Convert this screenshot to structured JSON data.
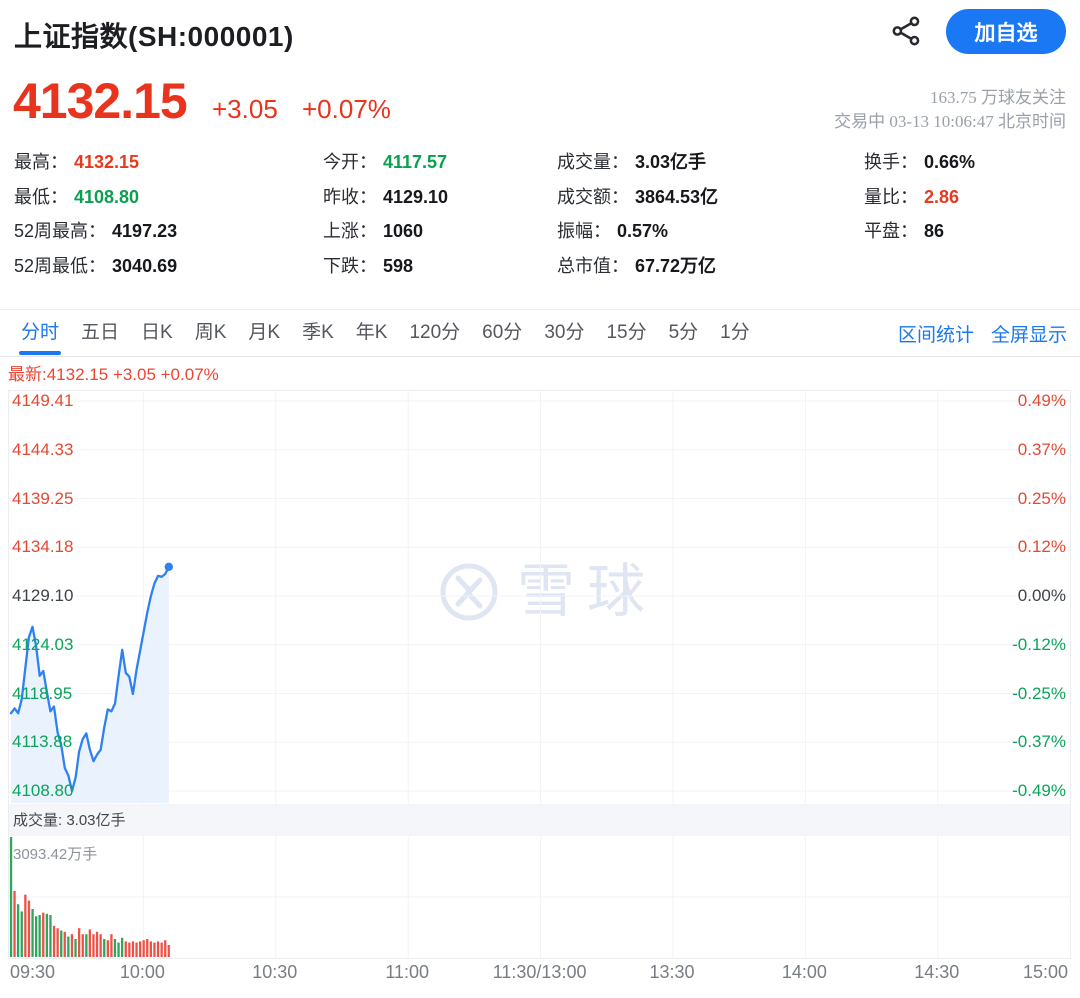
{
  "app": {
    "title": "上证指数(SH:000001)",
    "share_icon": "share-nodes-icon",
    "follow_button": "加自选"
  },
  "quote": {
    "price": "4132.15",
    "change": "+3.05",
    "change_pct": "+0.07%",
    "followers": "163.75 万球友关注",
    "session_status": "交易中 03-13 10:06:47 北京时间"
  },
  "stats": {
    "separator": "：",
    "columns": [
      {
        "items": [
          {
            "label": "最高",
            "value": "4132.15",
            "tone": "up"
          },
          {
            "label": "最低",
            "value": "4108.80",
            "tone": "down"
          },
          {
            "label": "52周最高",
            "value": "4197.23",
            "tone": "plain"
          },
          {
            "label": "52周最低",
            "value": "3040.69",
            "tone": "plain"
          }
        ]
      },
      {
        "items": [
          {
            "label": "今开",
            "value": "4117.57",
            "tone": "down"
          },
          {
            "label": "昨收",
            "value": "4129.10",
            "tone": "plain"
          },
          {
            "label": "上涨",
            "value": "1060",
            "tone": "plain"
          },
          {
            "label": "下跌",
            "value": "598",
            "tone": "plain"
          }
        ]
      },
      {
        "items": [
          {
            "label": "成交量",
            "value": "3.03亿手",
            "tone": "plain"
          },
          {
            "label": "成交额",
            "value": "3864.53亿",
            "tone": "plain"
          },
          {
            "label": "振幅",
            "value": "0.57%",
            "tone": "plain"
          },
          {
            "label": "总市值",
            "value": "67.72万亿",
            "tone": "plain"
          }
        ]
      },
      {
        "items": [
          {
            "label": "换手",
            "value": "0.66%",
            "tone": "plain"
          },
          {
            "label": "量比",
            "value": "2.86",
            "tone": "up"
          },
          {
            "label": "平盘",
            "value": "86",
            "tone": "plain"
          }
        ]
      }
    ]
  },
  "tabs": {
    "items": [
      {
        "id": "fenshi",
        "label": "分时",
        "active": true
      },
      {
        "id": "5day",
        "label": "五日",
        "active": false
      },
      {
        "id": "day-k",
        "label": "日K",
        "active": false
      },
      {
        "id": "week-k",
        "label": "周K",
        "active": false
      },
      {
        "id": "month-k",
        "label": "月K",
        "active": false
      },
      {
        "id": "quarter-k",
        "label": "季K",
        "active": false
      },
      {
        "id": "year-k",
        "label": "年K",
        "active": false
      },
      {
        "id": "120min",
        "label": "120分",
        "active": false
      },
      {
        "id": "60min",
        "label": "60分",
        "active": false
      },
      {
        "id": "30min",
        "label": "30分",
        "active": false
      },
      {
        "id": "15min",
        "label": "15分",
        "active": false
      },
      {
        "id": "5min",
        "label": "5分",
        "active": false
      },
      {
        "id": "1min",
        "label": "1分",
        "active": false
      }
    ],
    "links": [
      {
        "id": "range-stats",
        "label": "区间统计"
      },
      {
        "id": "fullscreen",
        "label": "全屏显示"
      }
    ]
  },
  "chart": {
    "latest_label": "最新:4132.15 +3.05 +0.07%",
    "volume_header": "成交量: 3.03亿手",
    "volume_max_label": "3093.42万手",
    "watermark_text": "雪球"
  },
  "colors": {
    "up": "#e8391f",
    "down": "#0aa04f",
    "accent_blue": "#1b78f4",
    "line": "#2f80f2",
    "area": "#e7f1fd",
    "vol_up": "#ee5247",
    "vol_down": "#2fa65c",
    "grid": "#f2f3f7"
  },
  "chart_data": {
    "type": "line",
    "title": "上证指数 分时走势",
    "prev_close": 4129.1,
    "open": 4117.57,
    "latest": 4132.15,
    "latest_time": "10:06",
    "x_ticks": [
      "09:30",
      "10:00",
      "10:30",
      "11:00",
      "11:30/13:00",
      "13:30",
      "14:00",
      "14:30",
      "15:00"
    ],
    "y_left_ticks": [
      "4149.41",
      "4144.33",
      "4139.25",
      "4134.18",
      "4129.10",
      "4124.03",
      "4118.95",
      "4113.88",
      "4108.80"
    ],
    "y_right_ticks": [
      "0.49%",
      "0.37%",
      "0.25%",
      "0.12%",
      "0.00%",
      "-0.12%",
      "-0.25%",
      "-0.37%",
      "-0.49%"
    ],
    "grid": true,
    "x_end_fraction": 0.149,
    "series": [
      {
        "name": "price",
        "values": [
          4116.9,
          4117.4,
          4116.9,
          4118.4,
          4121.6,
          4124.8,
          4125.9,
          4123.9,
          4120.8,
          4121.3,
          4119.1,
          4117.1,
          4117.6,
          4114.9,
          4113.6,
          4111.2,
          4110.4,
          4108.8,
          4110.2,
          4112.9,
          4114.2,
          4114.8,
          4113.1,
          4111.9,
          4112.6,
          4113.1,
          4115.4,
          4117.3,
          4117.1,
          4117.9,
          4120.8,
          4123.5,
          4121.1,
          4120.7,
          4118.9,
          4121.4,
          4123.4,
          4125.4,
          4127.4,
          4129.1,
          4130.4,
          4131.2,
          4131.1,
          4131.4,
          4132.15
        ]
      }
    ],
    "volume_bars": [
      {
        "v": 1.0,
        "d": "down"
      },
      {
        "v": 0.55,
        "d": "up"
      },
      {
        "v": 0.44,
        "d": "down"
      },
      {
        "v": 0.38,
        "d": "down"
      },
      {
        "v": 0.52,
        "d": "up"
      },
      {
        "v": 0.47,
        "d": "up"
      },
      {
        "v": 0.4,
        "d": "down"
      },
      {
        "v": 0.34,
        "d": "down"
      },
      {
        "v": 0.35,
        "d": "down"
      },
      {
        "v": 0.37,
        "d": "up"
      },
      {
        "v": 0.36,
        "d": "down"
      },
      {
        "v": 0.35,
        "d": "down"
      },
      {
        "v": 0.26,
        "d": "up"
      },
      {
        "v": 0.24,
        "d": "up"
      },
      {
        "v": 0.22,
        "d": "down"
      },
      {
        "v": 0.21,
        "d": "up"
      },
      {
        "v": 0.17,
        "d": "down"
      },
      {
        "v": 0.19,
        "d": "up"
      },
      {
        "v": 0.15,
        "d": "down"
      },
      {
        "v": 0.24,
        "d": "up"
      },
      {
        "v": 0.19,
        "d": "up"
      },
      {
        "v": 0.19,
        "d": "down"
      },
      {
        "v": 0.23,
        "d": "up"
      },
      {
        "v": 0.19,
        "d": "up"
      },
      {
        "v": 0.21,
        "d": "up"
      },
      {
        "v": 0.19,
        "d": "up"
      },
      {
        "v": 0.15,
        "d": "down"
      },
      {
        "v": 0.14,
        "d": "up"
      },
      {
        "v": 0.19,
        "d": "up"
      },
      {
        "v": 0.15,
        "d": "down"
      },
      {
        "v": 0.12,
        "d": "down"
      },
      {
        "v": 0.16,
        "d": "down"
      },
      {
        "v": 0.13,
        "d": "up"
      },
      {
        "v": 0.12,
        "d": "up"
      },
      {
        "v": 0.13,
        "d": "up"
      },
      {
        "v": 0.12,
        "d": "up"
      },
      {
        "v": 0.13,
        "d": "up"
      },
      {
        "v": 0.14,
        "d": "up"
      },
      {
        "v": 0.15,
        "d": "up"
      },
      {
        "v": 0.13,
        "d": "up"
      },
      {
        "v": 0.12,
        "d": "up"
      },
      {
        "v": 0.13,
        "d": "up"
      },
      {
        "v": 0.12,
        "d": "up"
      },
      {
        "v": 0.14,
        "d": "up"
      },
      {
        "v": 0.1,
        "d": "up"
      }
    ]
  }
}
